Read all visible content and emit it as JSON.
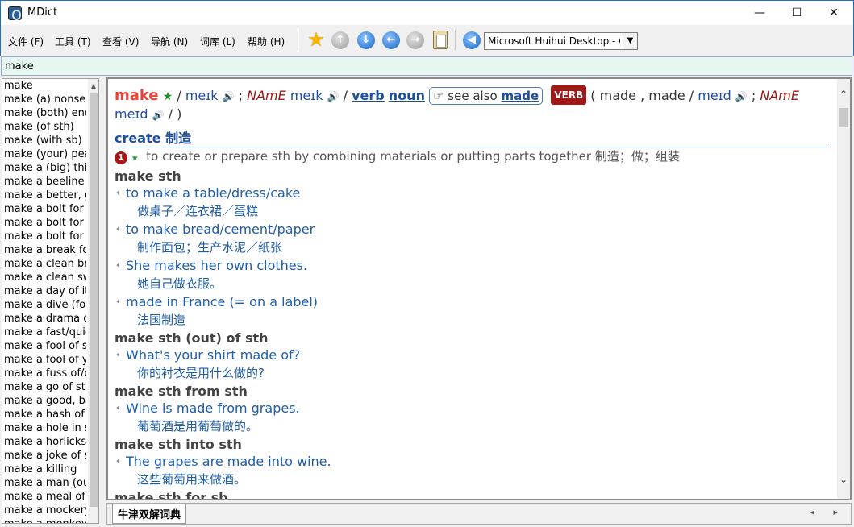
{
  "window": {
    "title": "MDict",
    "min": "—",
    "max": "☐",
    "close": "✕"
  },
  "menu": [
    "文件 (F)",
    "工具 (T)",
    "查看 (V)",
    "导航 (N)",
    "词库 (L)",
    "帮助 (H)"
  ],
  "toolbar": {
    "voice": "Microsoft Huihui Desktop - C",
    "voice_arrow": "▼"
  },
  "icons": {
    "star": "star-icon",
    "up": "arrow-up-icon",
    "down": "arrow-down-icon",
    "back": "arrow-left-icon",
    "forward": "arrow-right-icon",
    "clipboard": "clipboard-icon",
    "speak": "speaker-icon"
  },
  "search": {
    "value": "make"
  },
  "wordlist": [
    "make",
    "make (a) nonsen",
    "make (both) end",
    "make (of sth)",
    "make (with sb)",
    "make (your) peac",
    "make a (big) thin",
    "make a beeline fo",
    "make a better, go",
    "make a bolt for it",
    "make a bolt for s",
    "make a bolt for s",
    "make a break for",
    "make a clean bre",
    "make a clean swe",
    "make a day of it",
    "make a dive (for",
    "make a drama ou",
    "make a fast/quic",
    "make a fool of sl",
    "make a fool of yo",
    "make a fuss of/c",
    "make a go of sth",
    "make a good, ba",
    "make a hash of s",
    "make a hole in st",
    "make a horlicks c",
    "make a joke of st",
    "make a killing",
    "make a man (out",
    "make a meal of s",
    "make a mockery",
    "make a monkey"
  ],
  "entry": {
    "headword": "make",
    "star": "★",
    "slash": "/",
    "phon_br": "meɪk",
    "speaker": "🔊",
    "semicolon": ";",
    "name": "NAmE",
    "phon_am": "meɪk",
    "link_verb": "verb",
    "link_noun": "noun",
    "see_also_icon": "☞",
    "see_also_label": "see also",
    "see_also_link": "made",
    "badge": "VERB",
    "forms_open": "( made , made /",
    "phon_made": "meɪd",
    "phon_made_am": "meɪd",
    "forms_close": "/ )",
    "section": "create 制造",
    "def_num": "1",
    "definition": "to create or prepare sth by combining materials or putting parts together 制造；做；组装",
    "blocks": [
      {
        "pattern": "make sth",
        "examples": [
          {
            "en": "to make a table/dress/cake",
            "zh": "做桌子／连衣裙／蛋糕"
          },
          {
            "en": "to make bread/cement/paper",
            "zh": "制作面包；生产水泥／纸张"
          },
          {
            "en": "She makes her own clothes.",
            "zh": "她自己做衣服。"
          },
          {
            "en": "made in France (= on a label)",
            "zh": "法国制造"
          }
        ]
      },
      {
        "pattern": "make sth (out) of sth",
        "examples": [
          {
            "en": "What's your shirt made of?",
            "zh": "你的衬衣是用什么做的?"
          }
        ]
      },
      {
        "pattern": "make sth from sth",
        "examples": [
          {
            "en": "Wine is made from grapes.",
            "zh": "葡萄酒是用葡萄做的。"
          }
        ]
      },
      {
        "pattern": "make sth into sth",
        "examples": [
          {
            "en": "The grapes are made into wine.",
            "zh": "这些葡萄用来做酒。"
          }
        ]
      },
      {
        "pattern": "make sth for sb",
        "examples": []
      }
    ]
  },
  "tabs": {
    "active": "牛津双解词典",
    "arrows": "◂ ▸"
  }
}
